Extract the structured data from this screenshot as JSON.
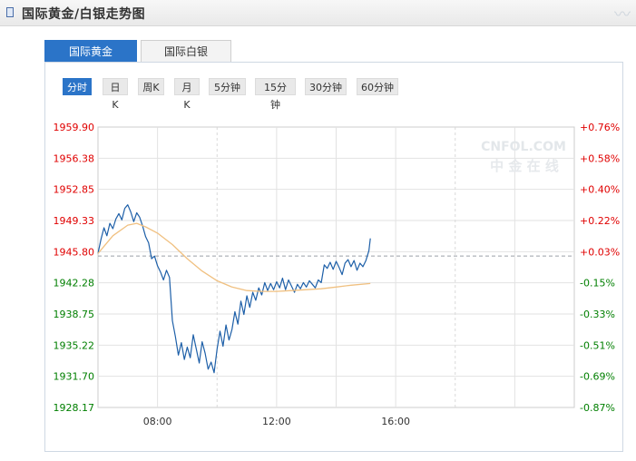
{
  "header": {
    "title": "国际黄金/白银走势图"
  },
  "tabs": [
    {
      "label": "国际黄金",
      "active": true
    },
    {
      "label": "国际白银",
      "active": false
    }
  ],
  "periods": [
    {
      "label": "分时",
      "active": true
    },
    {
      "label": "日K",
      "active": false
    },
    {
      "label": "周K",
      "active": false
    },
    {
      "label": "月K",
      "active": false
    },
    {
      "label": "5分钟",
      "active": false
    },
    {
      "label": "15分钟",
      "active": false
    },
    {
      "label": "30分钟",
      "active": false
    },
    {
      "label": "60分钟",
      "active": false
    }
  ],
  "watermark": {
    "line1": "CNFOL.COM",
    "line2": "中 金 在 线"
  },
  "colors": {
    "up": "#e00000",
    "down": "#007f00",
    "price_line": "#1d5fa8",
    "avg_line": "#f0c080",
    "tab_active": "#2b74c8"
  },
  "chart_data": {
    "type": "line",
    "title": "",
    "xlabel": "",
    "ylabel": "",
    "y_ticks": [
      "1959.90",
      "1956.38",
      "1952.85",
      "1949.33",
      "1945.80",
      "1942.28",
      "1938.75",
      "1935.22",
      "1931.70",
      "1928.17"
    ],
    "pct_ticks": [
      "+0.76%",
      "+0.58%",
      "+0.40%",
      "+0.22%",
      "+0.03%",
      "-0.15%",
      "-0.33%",
      "-0.51%",
      "-0.69%",
      "-0.87%"
    ],
    "x_ticks": [
      "08:00",
      "12:00",
      "16:00"
    ],
    "ylim": [
      1928.17,
      1959.9
    ],
    "reference_price": 1945.3,
    "grid": true,
    "series": [
      {
        "points": [
          [
            0,
            1945.6
          ],
          [
            0.1,
            1947.2
          ],
          [
            0.2,
            1948.5
          ],
          [
            0.3,
            1947.6
          ],
          [
            0.4,
            1949.0
          ],
          [
            0.5,
            1948.4
          ],
          [
            0.6,
            1949.5
          ],
          [
            0.7,
            1950.1
          ],
          [
            0.8,
            1949.4
          ],
          [
            0.9,
            1950.7
          ],
          [
            1.0,
            1951.1
          ],
          [
            1.1,
            1950.3
          ],
          [
            1.2,
            1949.2
          ],
          [
            1.3,
            1950.2
          ],
          [
            1.4,
            1949.7
          ],
          [
            1.5,
            1948.7
          ],
          [
            1.6,
            1947.5
          ],
          [
            1.7,
            1946.8
          ],
          [
            1.8,
            1945.0
          ],
          [
            1.9,
            1945.3
          ],
          [
            2.0,
            1944.2
          ],
          [
            2.1,
            1943.5
          ],
          [
            2.2,
            1942.6
          ],
          [
            2.3,
            1943.7
          ],
          [
            2.4,
            1942.9
          ],
          [
            2.5,
            1938.0
          ],
          [
            2.6,
            1936.2
          ],
          [
            2.7,
            1934.1
          ],
          [
            2.8,
            1935.5
          ],
          [
            2.9,
            1933.6
          ],
          [
            3.0,
            1935.0
          ],
          [
            3.1,
            1933.8
          ],
          [
            3.2,
            1936.4
          ],
          [
            3.3,
            1934.8
          ],
          [
            3.4,
            1933.2
          ],
          [
            3.5,
            1935.6
          ],
          [
            3.6,
            1934.3
          ],
          [
            3.7,
            1932.5
          ],
          [
            3.8,
            1933.3
          ],
          [
            3.9,
            1932.1
          ],
          [
            4.0,
            1934.8
          ],
          [
            4.1,
            1936.8
          ],
          [
            4.2,
            1935.1
          ],
          [
            4.3,
            1937.5
          ],
          [
            4.4,
            1935.8
          ],
          [
            4.5,
            1937.0
          ],
          [
            4.6,
            1939.0
          ],
          [
            4.7,
            1937.6
          ],
          [
            4.8,
            1940.2
          ],
          [
            4.9,
            1938.7
          ],
          [
            5.0,
            1940.8
          ],
          [
            5.1,
            1939.5
          ],
          [
            5.2,
            1941.2
          ],
          [
            5.3,
            1940.3
          ],
          [
            5.4,
            1941.7
          ],
          [
            5.5,
            1940.9
          ],
          [
            5.6,
            1942.3
          ],
          [
            5.7,
            1941.4
          ],
          [
            5.8,
            1942.2
          ],
          [
            5.9,
            1941.5
          ],
          [
            6.0,
            1942.4
          ],
          [
            6.1,
            1941.7
          ],
          [
            6.2,
            1942.8
          ],
          [
            6.3,
            1941.5
          ],
          [
            6.4,
            1942.6
          ],
          [
            6.5,
            1941.9
          ],
          [
            6.6,
            1941.2
          ],
          [
            6.7,
            1942.1
          ],
          [
            6.8,
            1941.6
          ],
          [
            6.9,
            1942.3
          ],
          [
            7.0,
            1941.8
          ],
          [
            7.1,
            1942.5
          ],
          [
            7.2,
            1942.1
          ],
          [
            7.3,
            1941.7
          ],
          [
            7.4,
            1942.6
          ],
          [
            7.5,
            1942.3
          ],
          [
            7.6,
            1944.3
          ],
          [
            7.7,
            1943.9
          ],
          [
            7.8,
            1944.6
          ],
          [
            7.9,
            1943.8
          ],
          [
            8.0,
            1944.7
          ],
          [
            8.1,
            1944.0
          ],
          [
            8.2,
            1943.2
          ],
          [
            8.3,
            1944.5
          ],
          [
            8.4,
            1944.9
          ],
          [
            8.5,
            1944.1
          ],
          [
            8.6,
            1944.8
          ],
          [
            8.7,
            1943.7
          ],
          [
            8.8,
            1944.5
          ],
          [
            8.9,
            1944.1
          ],
          [
            9.0,
            1944.8
          ],
          [
            9.1,
            1945.9
          ],
          [
            9.15,
            1947.3
          ]
        ]
      },
      {
        "points": [
          [
            0,
            1945.6
          ],
          [
            0.5,
            1947.6
          ],
          [
            1.0,
            1948.8
          ],
          [
            1.3,
            1949.0
          ],
          [
            1.6,
            1948.6
          ],
          [
            2.0,
            1947.9
          ],
          [
            2.5,
            1946.6
          ],
          [
            3.0,
            1945.0
          ],
          [
            3.5,
            1943.6
          ],
          [
            4.0,
            1942.5
          ],
          [
            4.5,
            1941.8
          ],
          [
            5.0,
            1941.4
          ],
          [
            5.5,
            1941.3
          ],
          [
            6.0,
            1941.3
          ],
          [
            6.5,
            1941.4
          ],
          [
            7.0,
            1941.5
          ],
          [
            7.5,
            1941.6
          ],
          [
            8.0,
            1941.8
          ],
          [
            8.5,
            1942.0
          ],
          [
            9.15,
            1942.2
          ]
        ]
      }
    ]
  }
}
